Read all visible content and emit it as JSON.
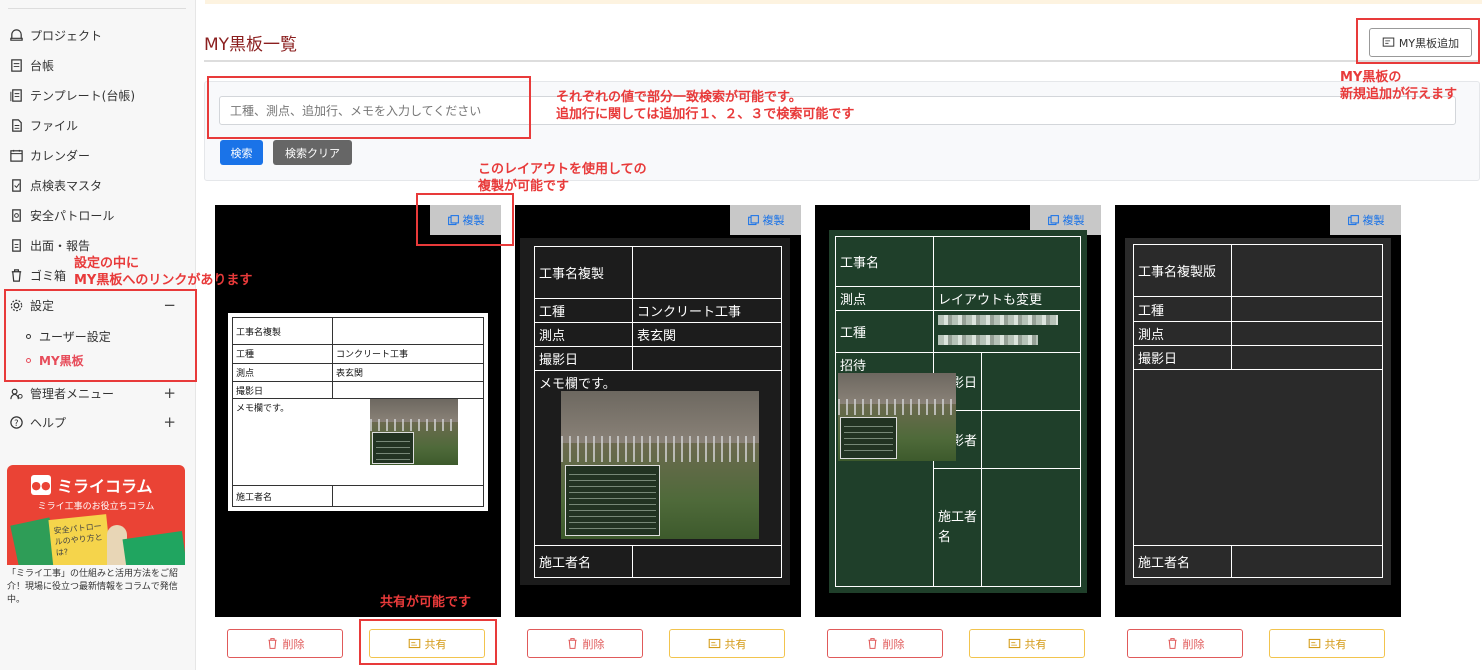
{
  "sidebar": {
    "items": [
      {
        "label": "プロジェクト",
        "icon": "project-icon"
      },
      {
        "label": "台帳",
        "icon": "ledger-icon"
      },
      {
        "label": "テンプレート(台帳)",
        "icon": "template-icon"
      },
      {
        "label": "ファイル",
        "icon": "file-icon"
      },
      {
        "label": "カレンダー",
        "icon": "calendar-icon"
      },
      {
        "label": "点検表マスタ",
        "icon": "checklist-icon"
      },
      {
        "label": "安全パトロール",
        "icon": "patrol-icon"
      },
      {
        "label": "出面・報告",
        "icon": "report-icon"
      },
      {
        "label": "ゴミ箱",
        "icon": "trash-icon"
      },
      {
        "label": "設定",
        "icon": "gear-icon",
        "toggle": "−"
      },
      {
        "label": "管理者メニュー",
        "icon": "admin-icon",
        "toggle": "+"
      },
      {
        "label": "ヘルプ",
        "icon": "help-icon",
        "toggle": "+"
      }
    ],
    "sub_items": [
      "ユーザー設定",
      "MY黒板"
    ],
    "banner": {
      "title": "ミライコラム",
      "subtitle": "ミライ工事のお役立ちコラム",
      "card_text": "安全パトロールのやり方とは?",
      "description": "「ミライ工事」の仕組みと活用方法をご紹介！現場に役立つ最新情報をコラムで発信中。"
    }
  },
  "main": {
    "title": "MY黒板一覧",
    "add_button": "MY黒板追加",
    "search": {
      "placeholder": "工種、測点、追加行、メモを入力してください",
      "search_button": "検索",
      "clear_button": "検索クリア"
    },
    "copy_label": "複製",
    "delete_label": "削除",
    "share_label": "共有",
    "boards": [
      {
        "background": "#000000",
        "rows": [
          {
            "label": "工事名複製",
            "value": ""
          },
          {
            "label": "工種",
            "value": "コンクリート工事"
          },
          {
            "label": "測点",
            "value": "表玄関"
          },
          {
            "label": "撮影日",
            "value": ""
          },
          {
            "label": "メモ欄です。",
            "value": ""
          },
          {
            "label": "施工者名",
            "value": ""
          }
        ]
      },
      {
        "background": "#000000",
        "rows": [
          {
            "label": "工事名複製",
            "value": ""
          },
          {
            "label": "工種",
            "value": "コンクリート工事"
          },
          {
            "label": "測点",
            "value": "表玄関"
          },
          {
            "label": "撮影日",
            "value": ""
          },
          {
            "label": "メモ欄です。",
            "value": ""
          },
          {
            "label": "施工者名",
            "value": ""
          }
        ]
      },
      {
        "background": "#1f3f2a",
        "rows": [
          {
            "label": "工事名",
            "value": ""
          },
          {
            "label": "測点",
            "value": "レイアウトも変更"
          },
          {
            "label": "工種",
            "value": ""
          },
          {
            "label": "招待",
            "value": ""
          },
          {
            "label": "撮影日",
            "value": ""
          },
          {
            "label": "撮影者",
            "value": ""
          },
          {
            "label": "施工者名",
            "value": ""
          }
        ]
      },
      {
        "background": "#2a2a2a",
        "rows": [
          {
            "label": "工事名複製版",
            "value": ""
          },
          {
            "label": "工種",
            "value": ""
          },
          {
            "label": "測点",
            "value": ""
          },
          {
            "label": "撮影日",
            "value": ""
          },
          {
            "label": "施工者名",
            "value": ""
          }
        ]
      }
    ]
  },
  "annotations": {
    "search_note_1": "それぞれの値で部分一致検索が可能です。",
    "search_note_2": "追加行に関しては追加行１、２、３で検索可能です",
    "add_note_1": "MY黒板の",
    "add_note_2": "新規追加が行えます",
    "copy_note_1": "このレイアウトを使用しての",
    "copy_note_2": "複製が可能です",
    "settings_note_1": "設定の中に",
    "settings_note_2": "MY黒板へのリンクがあります",
    "share_note": "共有が可能です"
  },
  "colors": {
    "accent_blue": "#1a73e8",
    "annotation_red": "#e83a3a",
    "delete_red": "#e05a5a",
    "share_yellow": "#f2c44e",
    "title_red": "#8b1f1f"
  }
}
